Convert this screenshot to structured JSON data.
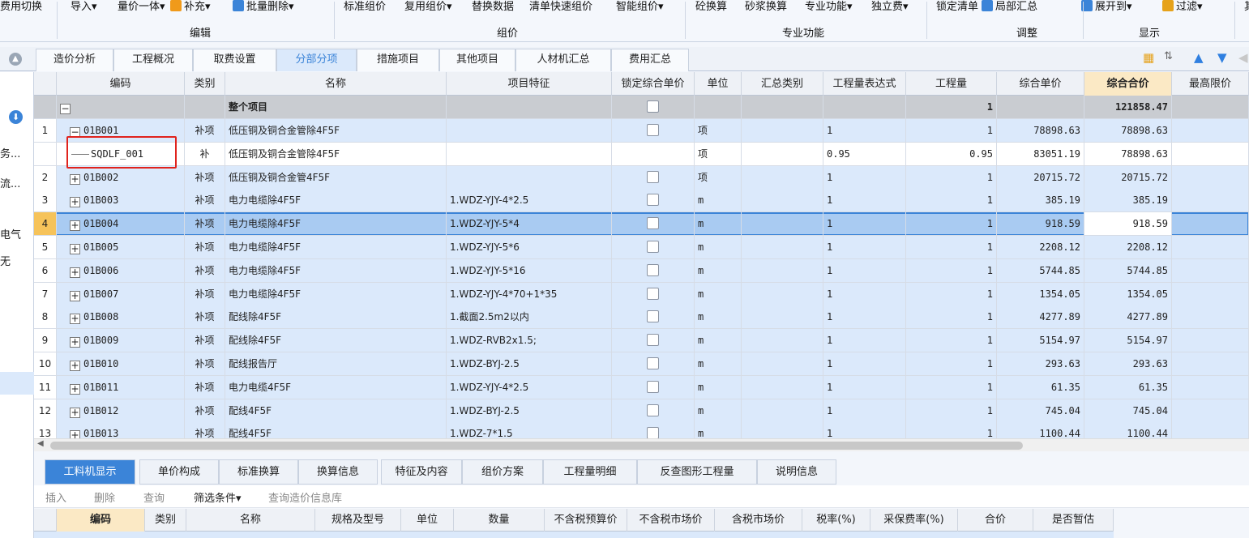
{
  "ribbon": {
    "buttons": [
      "费用切换",
      "导入▾",
      "量价一体▾",
      "补充▾",
      "批量删除▾",
      "标准组价",
      "复用组价▾",
      "替换数据",
      "清单快速组价",
      "智能组价▾",
      "砼换算",
      "砂浆换算",
      "专业功能▾",
      "独立费▾",
      "锁定清单",
      "局部汇总",
      "展开到▾",
      "过滤▾",
      "其"
    ],
    "groups": [
      "编辑",
      "组价",
      "专业功能",
      "调整",
      "显示"
    ]
  },
  "tabs": [
    "造价分析",
    "工程概况",
    "取费设置",
    "分部分项",
    "措施项目",
    "其他项目",
    "人材机汇总",
    "费用汇总"
  ],
  "active_tab": "分部分项",
  "sidebar": [
    "务...",
    "流...",
    "电气",
    "无"
  ],
  "grid": {
    "columns": [
      "编码",
      "类别",
      "名称",
      "项目特征",
      "锁定综合单价",
      "单位",
      "汇总类别",
      "工程量表达式",
      "工程量",
      "综合单价",
      "综合合价",
      "最高限价"
    ],
    "summary": {
      "name": "整个项目",
      "qty": "1",
      "total": "121858.47"
    },
    "rows": [
      {
        "no": "1",
        "sign": "−",
        "code": "01B001",
        "type": "补项",
        "name": "低压铜及铜合金管除4F5F",
        "feat": "",
        "unit": "项",
        "expr": "1",
        "qty": "1",
        "price": "78898.63",
        "total": "78898.63",
        "chk": true
      },
      {
        "no": "",
        "sign": "",
        "code": "SQDLF_001",
        "type": "补",
        "name": "低压铜及铜合金管除4F5F",
        "feat": "",
        "unit": "项",
        "expr": "0.95",
        "qty": "0.95",
        "price": "83051.19",
        "total": "78898.63",
        "chk": false,
        "child": true
      },
      {
        "no": "2",
        "sign": "+",
        "code": "01B002",
        "type": "补项",
        "name": "低压铜及铜合金管4F5F",
        "feat": "",
        "unit": "项",
        "expr": "1",
        "qty": "1",
        "price": "20715.72",
        "total": "20715.72",
        "chk": true
      },
      {
        "no": "3",
        "sign": "+",
        "code": "01B003",
        "type": "补项",
        "name": "电力电缆除4F5F",
        "feat": "1.WDZ-YJY-4*2.5",
        "unit": "m",
        "expr": "1",
        "qty": "1",
        "price": "385.19",
        "total": "385.19",
        "chk": true
      },
      {
        "no": "4",
        "sign": "+",
        "code": "01B004",
        "type": "补项",
        "name": "电力电缆除4F5F",
        "feat": "1.WDZ-YJY-5*4",
        "unit": "m",
        "expr": "1",
        "qty": "1",
        "price": "918.59",
        "total": "918.59",
        "chk": true,
        "selected": true
      },
      {
        "no": "5",
        "sign": "+",
        "code": "01B005",
        "type": "补项",
        "name": "电力电缆除4F5F",
        "feat": "1.WDZ-YJY-5*6",
        "unit": "m",
        "expr": "1",
        "qty": "1",
        "price": "2208.12",
        "total": "2208.12",
        "chk": true
      },
      {
        "no": "6",
        "sign": "+",
        "code": "01B006",
        "type": "补项",
        "name": "电力电缆除4F5F",
        "feat": "1.WDZ-YJY-5*16",
        "unit": "m",
        "expr": "1",
        "qty": "1",
        "price": "5744.85",
        "total": "5744.85",
        "chk": true
      },
      {
        "no": "7",
        "sign": "+",
        "code": "01B007",
        "type": "补项",
        "name": "电力电缆除4F5F",
        "feat": "1.WDZ-YJY-4*70+1*35",
        "unit": "m",
        "expr": "1",
        "qty": "1",
        "price": "1354.05",
        "total": "1354.05",
        "chk": true
      },
      {
        "no": "8",
        "sign": "+",
        "code": "01B008",
        "type": "补项",
        "name": "配线除4F5F",
        "feat": "1.截面2.5m2以内",
        "unit": "m",
        "expr": "1",
        "qty": "1",
        "price": "4277.89",
        "total": "4277.89",
        "chk": true
      },
      {
        "no": "9",
        "sign": "+",
        "code": "01B009",
        "type": "补项",
        "name": "配线除4F5F",
        "feat": "1.WDZ-RVB2x1.5;",
        "unit": "m",
        "expr": "1",
        "qty": "1",
        "price": "5154.97",
        "total": "5154.97",
        "chk": true
      },
      {
        "no": "10",
        "sign": "+",
        "code": "01B010",
        "type": "补项",
        "name": "配线报告厅",
        "feat": "1.WDZ-BYJ-2.5",
        "unit": "m",
        "expr": "1",
        "qty": "1",
        "price": "293.63",
        "total": "293.63",
        "chk": true
      },
      {
        "no": "11",
        "sign": "+",
        "code": "01B011",
        "type": "补项",
        "name": "电力电缆4F5F",
        "feat": "1.WDZ-YJY-4*2.5",
        "unit": "m",
        "expr": "1",
        "qty": "1",
        "price": "61.35",
        "total": "61.35",
        "chk": true
      },
      {
        "no": "12",
        "sign": "+",
        "code": "01B012",
        "type": "补项",
        "name": "配线4F5F",
        "feat": "1.WDZ-BYJ-2.5",
        "unit": "m",
        "expr": "1",
        "qty": "1",
        "price": "745.04",
        "total": "745.04",
        "chk": true
      },
      {
        "no": "13",
        "sign": "+",
        "code": "01B013",
        "type": "补项",
        "name": "配线4F5F",
        "feat": "1.WDZ-7*1.5",
        "unit": "m",
        "expr": "1",
        "qty": "1",
        "price": "1100.44",
        "total": "1100.44",
        "chk": true
      }
    ]
  },
  "bottom_tabs": [
    "工料机显示",
    "单价构成",
    "标准换算",
    "换算信息",
    "特征及内容",
    "组价方案",
    "工程量明细",
    "反查图形工程量",
    "说明信息"
  ],
  "bottom_toolbar": [
    "插入",
    "删除",
    "查询",
    "筛选条件▾",
    "查询造价信息库"
  ],
  "bottom_columns": [
    "编码",
    "类别",
    "名称",
    "规格及型号",
    "单位",
    "数量",
    "不含税预算价",
    "不含税市场价",
    "含税市场价",
    "税率(%)",
    "采保费率(%)",
    "合价",
    "是否暂估"
  ],
  "colors": {
    "accent": "#3b84d8",
    "selected_row": "#a9cbf2",
    "group_row": "#c9ccd1",
    "header_highlight": "#fbe9c5",
    "annotation": "#e0231d"
  }
}
